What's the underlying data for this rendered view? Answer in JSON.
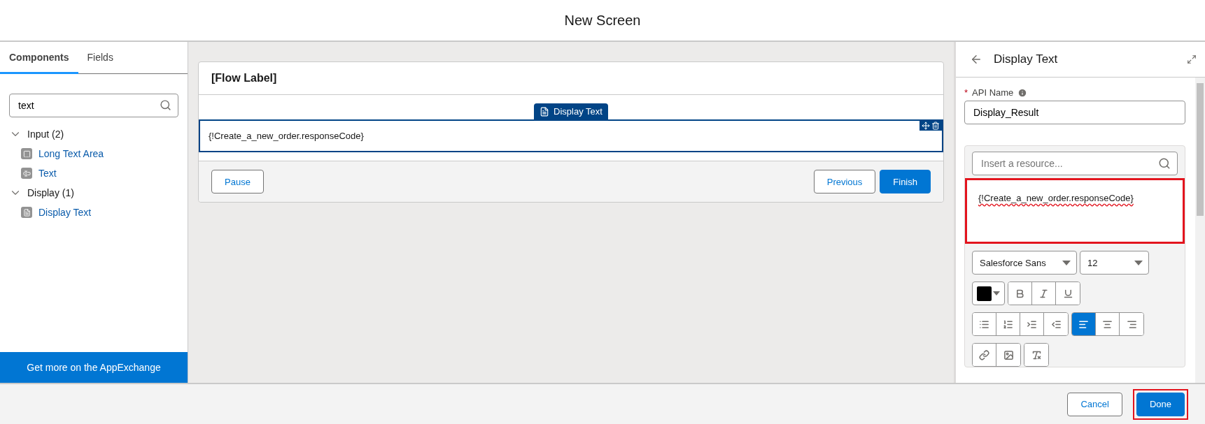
{
  "window": {
    "title": "New Screen"
  },
  "sidebar": {
    "tabs": [
      {
        "label": "Components",
        "selected": true
      },
      {
        "label": "Fields",
        "selected": false
      }
    ],
    "search": {
      "value": "text"
    },
    "groups": [
      {
        "label": "Input (2)",
        "expanded": true,
        "children": [
          {
            "label": "Long Text Area",
            "kind": "textarea"
          },
          {
            "label": "Text",
            "kind": "input"
          }
        ]
      },
      {
        "label": "Display (1)",
        "expanded": true,
        "children": [
          {
            "label": "Display Text",
            "kind": "display"
          }
        ]
      }
    ],
    "footer_link": "Get more on the AppExchange"
  },
  "canvas": {
    "title": "[Flow Label]",
    "component": {
      "tag": "Display Text",
      "content": "{!Create_a_new_order.responseCode}",
      "selected": true
    },
    "buttons": [
      {
        "label": "Pause",
        "kind": "neutral"
      },
      {
        "label": "Previous",
        "kind": "neutral"
      },
      {
        "label": "Finish",
        "kind": "brand"
      }
    ]
  },
  "properties": {
    "title": "Display Text",
    "api_name": {
      "required_mark": "*",
      "label": "API Name",
      "value": "Display_Result"
    },
    "resource_search": {
      "placeholder": "Insert a resource..."
    },
    "editor": {
      "content": "{!Create_a_new_order.responseCode}",
      "highlighted": true
    },
    "font": "Salesforce Sans",
    "size": "12",
    "toolbar": [
      [
        {
          "kind": "bold",
          "selected": false
        },
        {
          "kind": "italic",
          "selected": false
        },
        {
          "kind": "underline",
          "selected": false
        }
      ],
      [
        {
          "kind": "bullets",
          "selected": false
        },
        {
          "kind": "numbers",
          "selected": false
        },
        {
          "kind": "indent",
          "selected": false
        },
        {
          "kind": "outdent",
          "selected": false
        }
      ],
      [
        {
          "kind": "align-left",
          "selected": true
        },
        {
          "kind": "align-center",
          "selected": false
        },
        {
          "kind": "align-right",
          "selected": false
        }
      ],
      [
        {
          "kind": "link",
          "selected": false
        },
        {
          "kind": "image",
          "selected": false
        }
      ],
      [
        {
          "kind": "clear",
          "selected": false
        }
      ]
    ]
  },
  "footer": {
    "buttons": [
      {
        "label": "Cancel",
        "kind": "neutral",
        "highlighted": false
      },
      {
        "label": "Done",
        "kind": "brand",
        "highlighted": true
      }
    ]
  }
}
